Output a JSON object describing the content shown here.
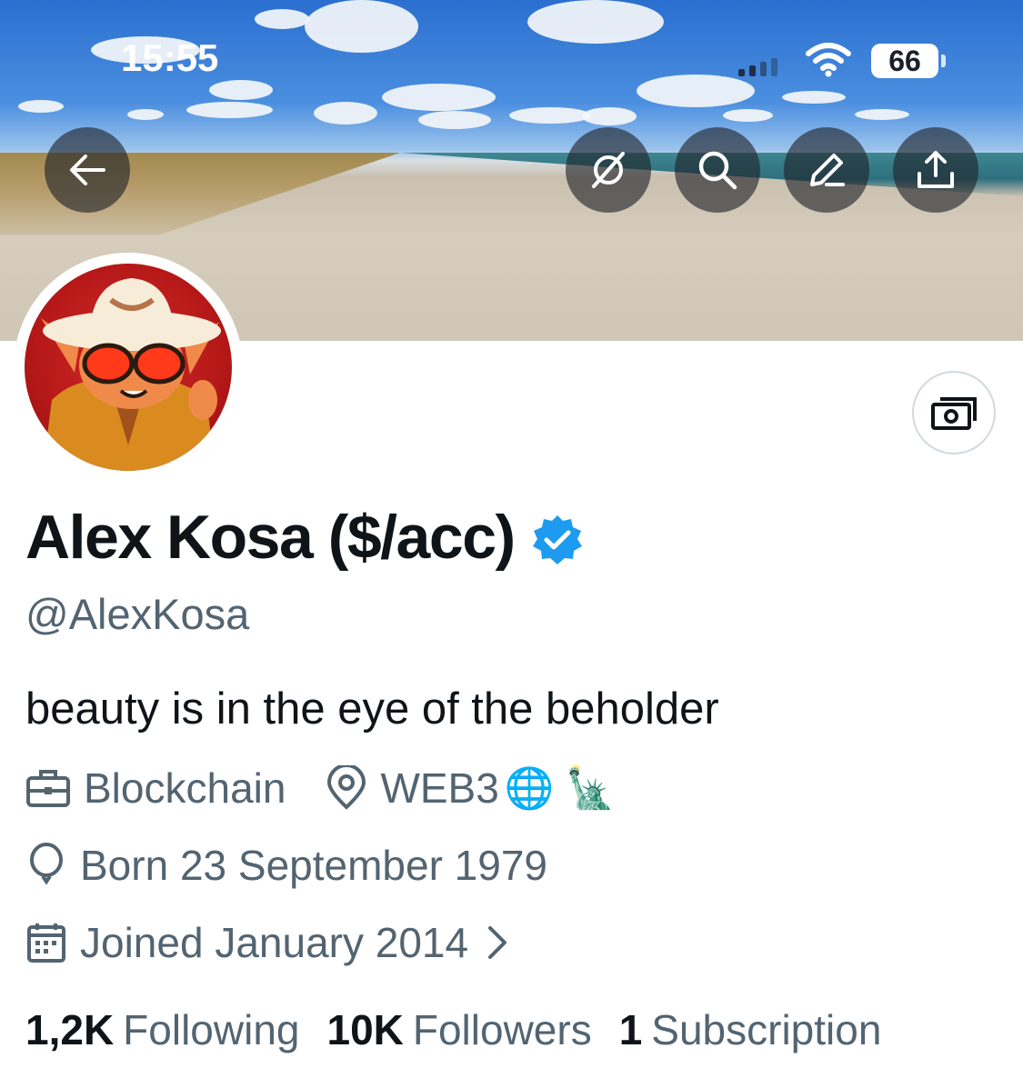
{
  "status_bar": {
    "time": "15:55",
    "battery": "66"
  },
  "toolbar": {
    "back_icon": "arrow-left-icon",
    "actions": [
      "grok-icon",
      "search-icon",
      "edit-icon",
      "share-icon"
    ]
  },
  "profile": {
    "display_name": "Alex Kosa ($/acc)",
    "verified": true,
    "handle": "@AlexKosa",
    "bio": "beauty is in the eye of the beholder",
    "category": "Blockchain",
    "location": "WEB3",
    "location_emojis": "🌐 🗽",
    "birth": "Born 23 September 1979",
    "joined": "Joined January 2014"
  },
  "stats": {
    "following_count": "1,2K",
    "following_label": "Following",
    "followers_count": "10K",
    "followers_label": "Followers",
    "subscription_count": "1",
    "subscription_label": "Subscription"
  },
  "colors": {
    "text_primary": "#0f1419",
    "text_secondary": "#536471",
    "verified_blue": "#1d9bf0",
    "border": "#cfd9de"
  }
}
